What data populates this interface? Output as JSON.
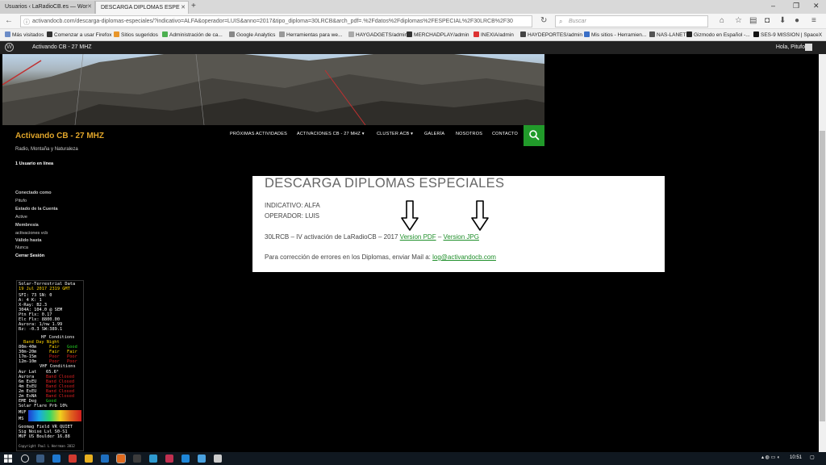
{
  "browser": {
    "tabs": [
      {
        "title": "Usuarios ‹ LaRadioCB.es — Wor"
      },
      {
        "title": "DESCARGA DIPLOMAS ESPE"
      }
    ],
    "url": "activandocb.com/descarga-diplomas-especiales/?indicativo=ALFA&operador=LUIS&anno=2017&tipo_diploma=30LRCB&arch_pdf=.%2Fdatos%2Fdiplomas%2FESPECIAL%2F30LRCB%2F30",
    "search_placeholder": "Buscar",
    "bookmarks": [
      {
        "label": "Más visitados",
        "color": "#6b8cc7"
      },
      {
        "label": "Comenzar a usar Firefox",
        "color": "#333"
      },
      {
        "label": "Sitios sugeridos",
        "color": "#e8962a"
      },
      {
        "label": "Administración de ca...",
        "color": "#4caf50"
      },
      {
        "label": "Google Analytics",
        "color": "#888"
      },
      {
        "label": "Herramientas para we...",
        "color": "#999"
      },
      {
        "label": "HAYGADGETS/admin",
        "color": "#aaa"
      },
      {
        "label": "MERCHADPLAY/admin",
        "color": "#333"
      },
      {
        "label": "INEXIA/admin",
        "color": "#d33"
      },
      {
        "label": "HAYDEPORTES/admin",
        "color": "#444"
      },
      {
        "label": "Mis sitios - Herramien...",
        "color": "#3a6fc7"
      },
      {
        "label": "NAS-LANET",
        "color": "#555"
      },
      {
        "label": "Gizmodo en Español -...",
        "color": "#222"
      },
      {
        "label": "SES-9 MISSION | SpaceX",
        "color": "#111"
      }
    ]
  },
  "wp_admin": {
    "site_name": "Activando CB - 27 MHZ",
    "greeting": "Hola, Pitufo"
  },
  "site": {
    "title": "Activando CB - 27 MHZ",
    "tagline": "Radio, Montaña y Naturaleza",
    "menu": [
      {
        "label": "PRÓXIMAS ACTIVIDADES",
        "has_sub": false
      },
      {
        "label": "ACTIVACIONES CB - 27 MHZ",
        "has_sub": true
      },
      {
        "label": "CLUSTER ACB",
        "has_sub": true
      },
      {
        "label": "GALERÍA",
        "has_sub": false
      },
      {
        "label": "NOSOTROS",
        "has_sub": false
      },
      {
        "label": "CONTACTO",
        "has_sub": false
      }
    ]
  },
  "sidebar": {
    "online": "1 Usuario en línea",
    "connected_as_label": "Conectado como",
    "connected_as_value": "Pitufo",
    "account_status_label": "Estado de la Cuenta",
    "account_status_value": "Active",
    "membership_label": "Membresía",
    "membership_value": "activaciones vcb",
    "valid_until_label": "Válido hasta",
    "valid_until_value": "Nunca",
    "logout": "Cerrar Sesión"
  },
  "content": {
    "heading": "DESCARGA DIPLOMAS ESPECIALES",
    "indicativo": "INDICATIVO: ALFA",
    "operador": "OPERADOR: LUIS",
    "activation_text": "30LRCB – IV activación de LaRadioCB – 2017",
    "link_pdf": "Version PDF",
    "separator": "–",
    "link_jpg": "Version JPG",
    "correction_text": "Para corrección de errores en los Diplomas, enviar Mail a:",
    "email": "log@activandocb.com"
  },
  "solar": {
    "title": "Solar-Terrestrial Data",
    "date": "19 Jul 2017 2319 GMT",
    "rows": [
      {
        "text": "SFI: 73    SN:  0",
        "color": "#ffffff"
      },
      {
        "text": "A:  4    K: 1",
        "color": "#ffffff"
      },
      {
        "text": "X-Ray: B2.3",
        "color": "#ffffff"
      },
      {
        "text": "304A: 104.0 @ SEM",
        "color": "#ffffff"
      },
      {
        "text": "Ptn Flx: 0.17",
        "color": "#ffffff"
      },
      {
        "text": "Elc Flx: 8800.00",
        "color": "#ffffff"
      },
      {
        "text": "Aurora:  1/nw 1.99",
        "color": "#ffffff"
      },
      {
        "text": "Bz: -0.3 SW:389.1",
        "color": "#ffffff"
      }
    ],
    "hf_title": "HF Conditions",
    "hf_header": "Band    Day   Night",
    "hf_rows": [
      {
        "band": "80m-40m",
        "day": "Fair",
        "night": "Good",
        "day_color": "#ffd400",
        "night_color": "#26d426"
      },
      {
        "band": "30m-20m",
        "day": "Fair",
        "night": "Fair",
        "day_color": "#ffd400",
        "night_color": "#ffd400"
      },
      {
        "band": "17m-15m",
        "day": "Poor",
        "night": "Poor",
        "day_color": "#e02020",
        "night_color": "#e02020"
      },
      {
        "band": "12m-10m",
        "day": "Poor",
        "night": "Poor",
        "day_color": "#e02020",
        "night_color": "#e02020"
      }
    ],
    "vhf_title": "VHF Conditions",
    "vhf_rows": [
      {
        "name": "Aur Lat",
        "value": "65.6°",
        "color": "#ffffff"
      },
      {
        "name": "Aurora",
        "value": "Band Closed",
        "color": "#e02020"
      },
      {
        "name": "6m EsEU",
        "value": "Band Closed",
        "color": "#e02020"
      },
      {
        "name": "4m EsEU",
        "value": "Band Closed",
        "color": "#e02020"
      },
      {
        "name": "2m EsEU",
        "value": "Band Closed",
        "color": "#e02020"
      },
      {
        "name": "2m EsNA",
        "value": "Band Closed",
        "color": "#e02020"
      },
      {
        "name": "EME Deg",
        "value": "Good",
        "color": "#26d426"
      }
    ],
    "flare": "Solar Flare Prb  10%",
    "muf_label": "MUF",
    "ms_label": "MS",
    "geomag": "Geomag Field  VR QUIET",
    "sig_noise": "Sig Noise Lvl  S0-S1",
    "muf_boulder": "MUF US Boulder 16.88",
    "copyright": "Copyright Paul L Herrman 2012"
  },
  "taskbar": {
    "time": "10:51"
  }
}
